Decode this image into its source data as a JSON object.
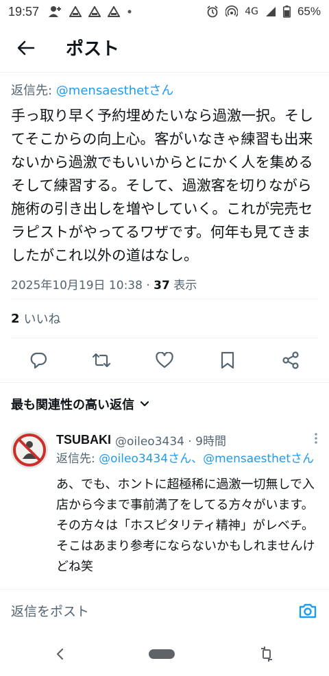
{
  "status_bar": {
    "time": "19:57",
    "network": "4G",
    "battery": "65%"
  },
  "header": {
    "title": "ポスト"
  },
  "post": {
    "reply_to_prefix": "返信先: ",
    "reply_to_handle": "@mensaesthetさん",
    "text": "手っ取り早く予約埋めたいなら過激一択。そしてそこからの向上心。客がいなきゃ練習も出来ないから過激でもいいからとにかく人を集めるそして練習する。そして、過激客を切りながら施術の引き出しを増やしていく。これが完売セラピストがやってるワザです。何年も見てきましたがこれ以外の道はなし。",
    "timestamp": "2025年10月19日 10:38",
    "separator": " · ",
    "views": "37",
    "views_label": " 表示",
    "likes": "2",
    "likes_label": "いいね"
  },
  "sort": {
    "label": "最も関連性の高い返信"
  },
  "reply": {
    "name": "TSUBAKI",
    "handle": "@oileo3434 · 9時間",
    "reply_to_prefix": "返信先: ",
    "reply_to_handles": "@oileo3434さん、@mensaesthetさん",
    "text": "あ、でも、ホントに超極稀に過激一切無しで入店から今まで事前満了をしてる方々がいます。その方々は「ホスピタリティ精神」がレベチ。そこはあまり参考にならないかもしれませんけどね笑"
  },
  "compose": {
    "placeholder": "返信をポスト"
  },
  "colors": {
    "accent": "#1d9bf0",
    "muted": "#536471",
    "text": "#0f1419"
  }
}
